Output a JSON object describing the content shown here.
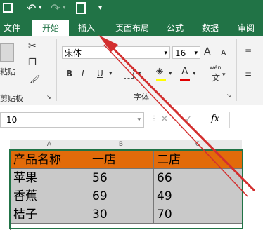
{
  "colors": {
    "excel_green": "#217346",
    "header_orange": "#e26b0a",
    "data_gray": "#c9c9c9",
    "arrow_red": "#d32f2f"
  },
  "quick_access": {
    "save_icon": "save-icon",
    "undo_icon": "undo-icon",
    "redo_icon": "redo-icon",
    "preview_icon": "print-preview-icon",
    "more": "▾"
  },
  "tabs": [
    {
      "label": "文件"
    },
    {
      "label": "开始",
      "active": true
    },
    {
      "label": "插入"
    },
    {
      "label": "页面布局"
    },
    {
      "label": "公式"
    },
    {
      "label": "数据"
    },
    {
      "label": "审阅"
    }
  ],
  "ribbon": {
    "clipboard": {
      "paste": "粘贴",
      "label": "剪贴板"
    },
    "font": {
      "name": "宋体",
      "size": "16",
      "grow": "A",
      "shrink": "A",
      "bold": "B",
      "italic": "I",
      "underline": "U",
      "font_color_letter": "A",
      "wen": "wén",
      "wen_char": "文",
      "label": "字体"
    }
  },
  "formula_bar": {
    "name_box": "10",
    "fx": "fx",
    "cancel": "✕",
    "enter": "✓"
  },
  "columns": [
    "A",
    "B",
    "C"
  ],
  "table": {
    "headers": [
      "产品名称",
      "一店",
      "二店"
    ],
    "rows": [
      [
        "苹果",
        "56",
        "66"
      ],
      [
        "香蕉",
        "69",
        "49"
      ],
      [
        "桔子",
        "30",
        "70"
      ]
    ]
  }
}
